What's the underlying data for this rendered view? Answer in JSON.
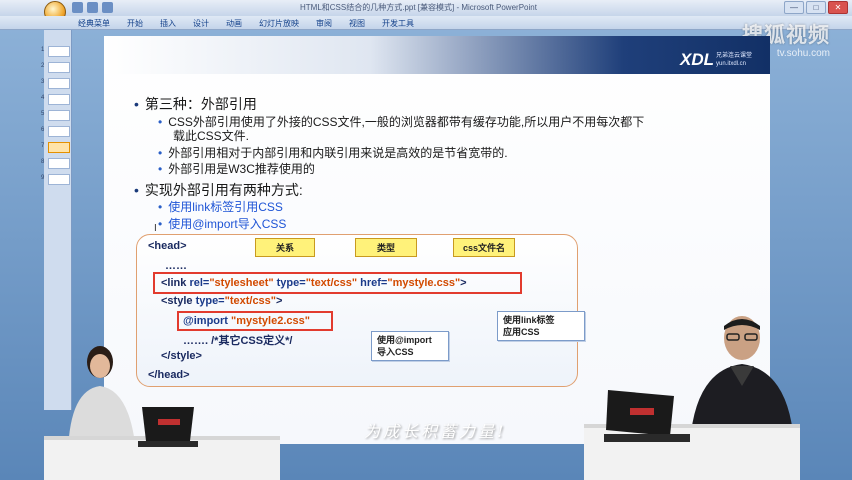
{
  "window": {
    "title": "HTML和CSS结合的几种方式.ppt [兼容模式] - Microsoft PowerPoint",
    "controls": [
      "—",
      "□",
      "✕"
    ]
  },
  "ribbon": {
    "tabs": [
      "经典菜单",
      "开始",
      "插入",
      "设计",
      "动画",
      "幻灯片放映",
      "审阅",
      "视图",
      "开发工具"
    ]
  },
  "watermark": {
    "brand": "搜狐视频",
    "url": "tv.sohu.com"
  },
  "slide_pane": {
    "numbers": [
      "1",
      "2",
      "3",
      "4",
      "5",
      "6",
      "7",
      "8",
      "9"
    ],
    "active_index": 6
  },
  "slide": {
    "logo": "XDL",
    "logo_sub": "兄弟连云课堂 yun.itxdl.cn",
    "heading1": "第三种：外部引用",
    "bullets1": [
      "CSS外部引用使用了外接的CSS文件,一般的浏览器都带有缓存功能,所以用户不用每次都下",
      "载此CSS文件.",
      "外部引用相对于内部引用和内联引用来说是高效的是节省宽带的.",
      "外部引用是W3C推荐使用的"
    ],
    "heading2": "实现外部引用有两种方式:",
    "bullets2": [
      "使用link标签引用CSS",
      "使用@import导入CSS"
    ],
    "code": {
      "head_open": "<head>",
      "dots1": "……",
      "link_line": {
        "p1": "<link ",
        "a1": "rel=",
        "v1": "\"stylesheet\"",
        "a2": " type=",
        "v2": "\"text/css\"",
        "a3": " href=",
        "v3": "\"mystyle.css\"",
        "p2": ">"
      },
      "style_open": {
        "p1": "<style ",
        "a1": "type=",
        "v1": "\"text/css\"",
        "p2": ">"
      },
      "import_line": {
        "kw": "@import ",
        "v": "\"mystyle2.css\""
      },
      "comment_line": "……. /*其它CSS定义*/",
      "style_close": "</style>",
      "head_close": "</head>"
    },
    "callouts": {
      "relation": "关系",
      "type": "类型",
      "filename": "css文件名",
      "link_note": [
        "使用link标签",
        "应用CSS"
      ],
      "import_note": [
        "使用@import",
        "导入CSS"
      ]
    }
  },
  "scene": {
    "slogan": "为成长积蓄力量!"
  }
}
